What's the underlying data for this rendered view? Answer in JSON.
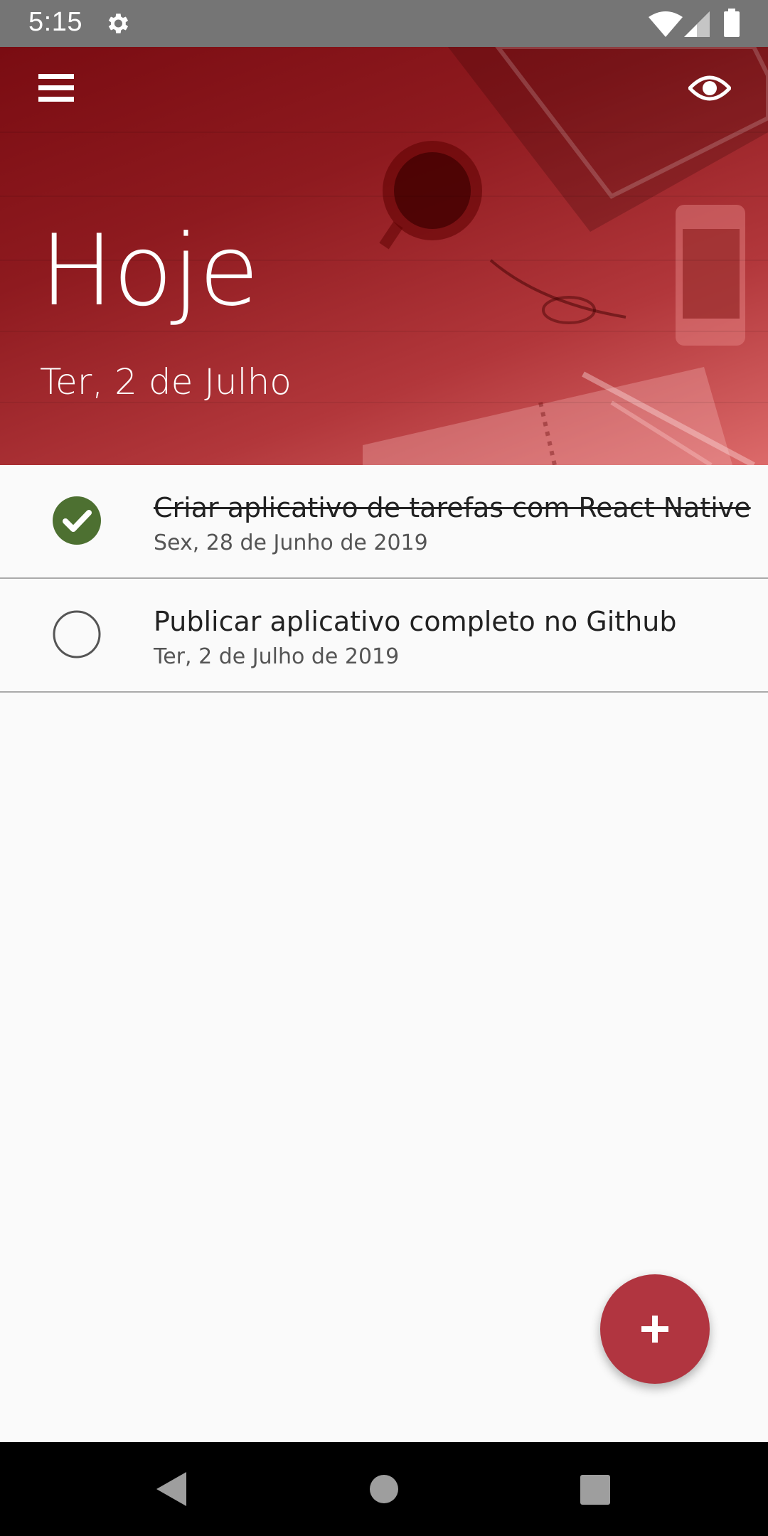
{
  "status_bar": {
    "time": "5:15",
    "icons": [
      "settings-gear-icon",
      "wifi-icon",
      "cell-signal-icon",
      "battery-icon"
    ]
  },
  "header": {
    "title": "Hoje",
    "date": "Ter, 2 de Julho",
    "menu_icon": "hamburger-menu-icon",
    "visibility_icon": "eye-icon"
  },
  "tasks": [
    {
      "description": "Criar aplicativo de tarefas com React Native",
      "date": "Sex, 28 de Junho de 2019",
      "done": true
    },
    {
      "description": "Publicar aplicativo completo no Github",
      "date": "Ter, 2 de Julho de 2019",
      "done": false
    }
  ],
  "fab": {
    "icon": "plus-icon"
  },
  "colors": {
    "accent": "#b13540",
    "check_done": "#4d7031",
    "header_dark": "#7a0c12",
    "header_light": "#dc6a6a"
  },
  "nav_bar": {
    "icons": [
      "back-icon",
      "home-icon",
      "recents-icon"
    ]
  }
}
